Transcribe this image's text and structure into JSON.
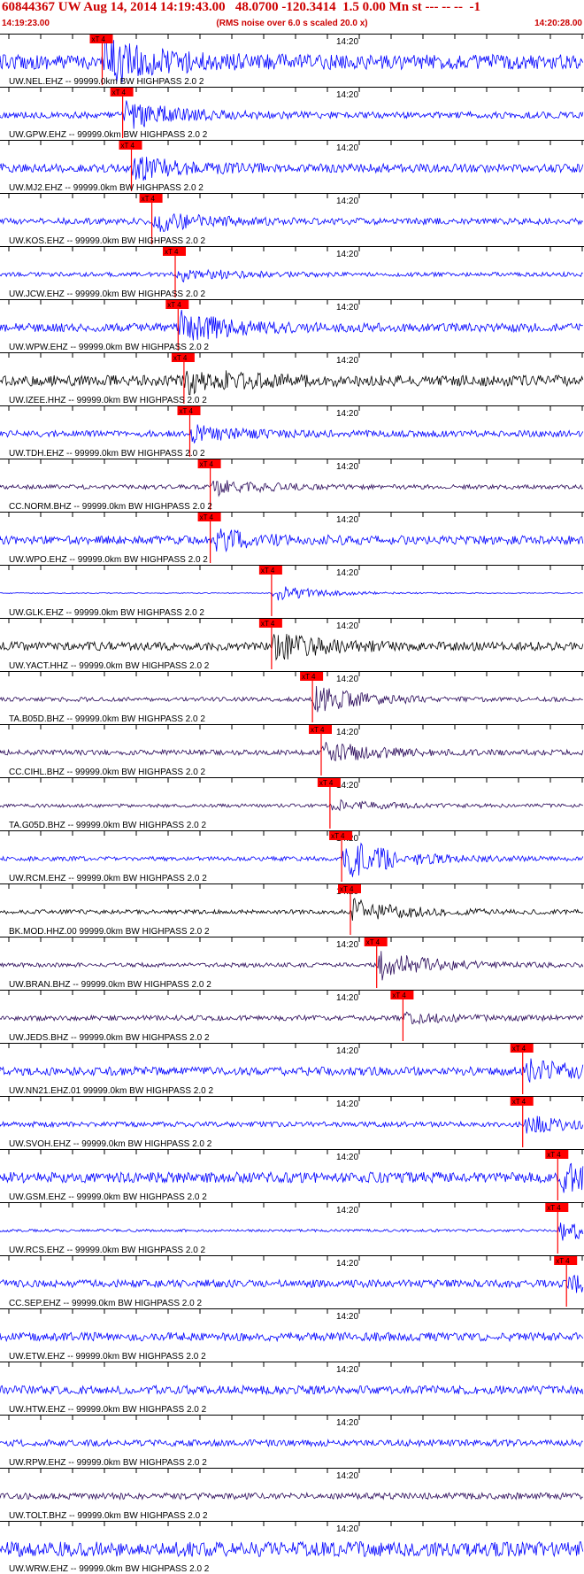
{
  "header": {
    "title": "60844367 UW Aug 14, 2014 14:19:43.00   48.0700 -120.3414  1.5 0.00 Mn st --- -- --  -1",
    "subtitle": "(RMS noise over 6.0 s scaled 20.0 x)",
    "start_time": "14:19:23.00",
    "end_time": "14:20:28.00"
  },
  "pick_label": "xT 4",
  "minute_label": "14:20",
  "colors": {
    "title": "#cc0000",
    "pick": "#ff0000",
    "blue": "#0000ff",
    "black": "#000000",
    "purple": "#2a0a5a"
  },
  "traces": [
    {
      "label": "UW.NEL.EHZ -- 99999.0km BW  HIGHPASS  2.0  2",
      "color": "blue",
      "pick": 0.175,
      "amp": 1.0,
      "noise": 0.35
    },
    {
      "label": "UW.GPW.EHZ -- 99999.0km BW  HIGHPASS  2.0  2",
      "color": "blue",
      "pick": 0.21,
      "amp": 0.7,
      "noise": 0.15
    },
    {
      "label": "UW.MJ2.EHZ -- 99999.0km BW  HIGHPASS  2.0  2",
      "color": "blue",
      "pick": 0.225,
      "amp": 0.5,
      "noise": 0.2
    },
    {
      "label": "UW.KOS.EHZ -- 99999.0km BW  HIGHPASS  2.0  2",
      "color": "blue",
      "pick": 0.26,
      "amp": 0.45,
      "noise": 0.15
    },
    {
      "label": "UW.JCW.EHZ -- 99999.0km BW  HIGHPASS  2.0  2",
      "color": "blue",
      "pick": 0.3,
      "amp": 0.3,
      "noise": 0.1
    },
    {
      "label": "UW.WPW.EHZ -- 99999.0km BW  HIGHPASS  2.0  2",
      "color": "blue",
      "pick": 0.305,
      "amp": 0.7,
      "noise": 0.2
    },
    {
      "label": "UW.IZEE.HHZ -- 99999.0km BW  HIGHPASS  2.0  2",
      "color": "black",
      "pick": 0.315,
      "amp": 0.6,
      "noise": 0.25
    },
    {
      "label": "UW.TDH.EHZ -- 99999.0km BW  HIGHPASS  2.0  2",
      "color": "blue",
      "pick": 0.325,
      "amp": 0.35,
      "noise": 0.15
    },
    {
      "label": "CC.NORM.BHZ -- 99999.0km BW  HIGHPASS  2.0  2",
      "color": "purple",
      "pick": 0.36,
      "amp": 0.4,
      "noise": 0.1
    },
    {
      "label": "UW.WPO.EHZ -- 99999.0km BW  HIGHPASS  2.0  2",
      "color": "blue",
      "pick": 0.36,
      "amp": 0.45,
      "noise": 0.2
    },
    {
      "label": "UW.GLK.EHZ -- 99999.0km BW  HIGHPASS  2.0  2",
      "color": "blue",
      "pick": 0.465,
      "amp": 0.4,
      "noise": 0.02
    },
    {
      "label": "UW.YACT.HHZ -- 99999.0km BW  HIGHPASS  2.0  2",
      "color": "black",
      "pick": 0.465,
      "amp": 0.6,
      "noise": 0.2
    },
    {
      "label": "TA.B05D.BHZ -- 99999.0km BW  HIGHPASS  2.0  2",
      "color": "purple",
      "pick": 0.535,
      "amp": 0.6,
      "noise": 0.1
    },
    {
      "label": "CC.CIHL.BHZ -- 99999.0km BW  HIGHPASS  2.0  2",
      "color": "purple",
      "pick": 0.55,
      "amp": 0.55,
      "noise": 0.12
    },
    {
      "label": "TA.G05D.BHZ -- 99999.0km BW  HIGHPASS  2.0  2",
      "color": "purple",
      "pick": 0.565,
      "amp": 0.25,
      "noise": 0.08
    },
    {
      "label": "UW.RCM.EHZ -- 99999.0km BW  HIGHPASS  2.0  2",
      "color": "blue",
      "pick": 0.585,
      "amp": 1.0,
      "noise": 0.1
    },
    {
      "label": "BK.MOD.HHZ.00 99999.0km BW  HIGHPASS  2.0  2",
      "color": "black",
      "pick": 0.6,
      "amp": 0.6,
      "noise": 0.1
    },
    {
      "label": "UW.BRAN.BHZ -- 99999.0km BW  HIGHPASS  2.0  2",
      "color": "purple",
      "pick": 0.645,
      "amp": 0.7,
      "noise": 0.1
    },
    {
      "label": "UW.JEDS.BHZ -- 99999.0km BW  HIGHPASS  2.0  2",
      "color": "purple",
      "pick": 0.69,
      "amp": 0.2,
      "noise": 0.12
    },
    {
      "label": "UW.NN21.EHZ.01 99999.0km BW  HIGHPASS  2.0  2",
      "color": "blue",
      "pick": 0.895,
      "amp": 0.5,
      "noise": 0.2
    },
    {
      "label": "UW.SVOH.EHZ -- 99999.0km BW  HIGHPASS  2.0  2",
      "color": "blue",
      "pick": 0.895,
      "amp": 0.4,
      "noise": 0.12
    },
    {
      "label": "UW.GSM.EHZ -- 99999.0km BW  HIGHPASS  2.0  2",
      "color": "blue",
      "pick": 0.955,
      "amp": 0.6,
      "noise": 0.25
    },
    {
      "label": "UW.RCS.EHZ -- 99999.0km BW  HIGHPASS  2.0  2",
      "color": "blue",
      "pick": 0.955,
      "amp": 0.5,
      "noise": 0.06
    },
    {
      "label": "CC.SEP.EHZ -- 99999.0km BW  HIGHPASS  2.0  2",
      "color": "blue",
      "pick": 0.97,
      "amp": 0.35,
      "noise": 0.18
    },
    {
      "label": "UW.ETW.EHZ -- 99999.0km BW  HIGHPASS  2.0  2",
      "color": "blue",
      "pick": null,
      "amp": 0.2,
      "noise": 0.2
    },
    {
      "label": "UW.HTW.EHZ -- 99999.0km BW  HIGHPASS  2.0  2",
      "color": "blue",
      "pick": null,
      "amp": 0.2,
      "noise": 0.2
    },
    {
      "label": "UW.RPW.EHZ -- 99999.0km BW  HIGHPASS  2.0  2",
      "color": "blue",
      "pick": null,
      "amp": 0.2,
      "noise": 0.15
    },
    {
      "label": "UW.TOLT.BHZ -- 99999.0km BW  HIGHPASS  2.0  2",
      "color": "purple",
      "pick": null,
      "amp": 0.15,
      "noise": 0.15
    },
    {
      "label": "UW.WRW.EHZ -- 99999.0km BW  HIGHPASS  2.0  2",
      "color": "blue",
      "pick": null,
      "amp": 0.5,
      "noise": 0.35
    }
  ]
}
